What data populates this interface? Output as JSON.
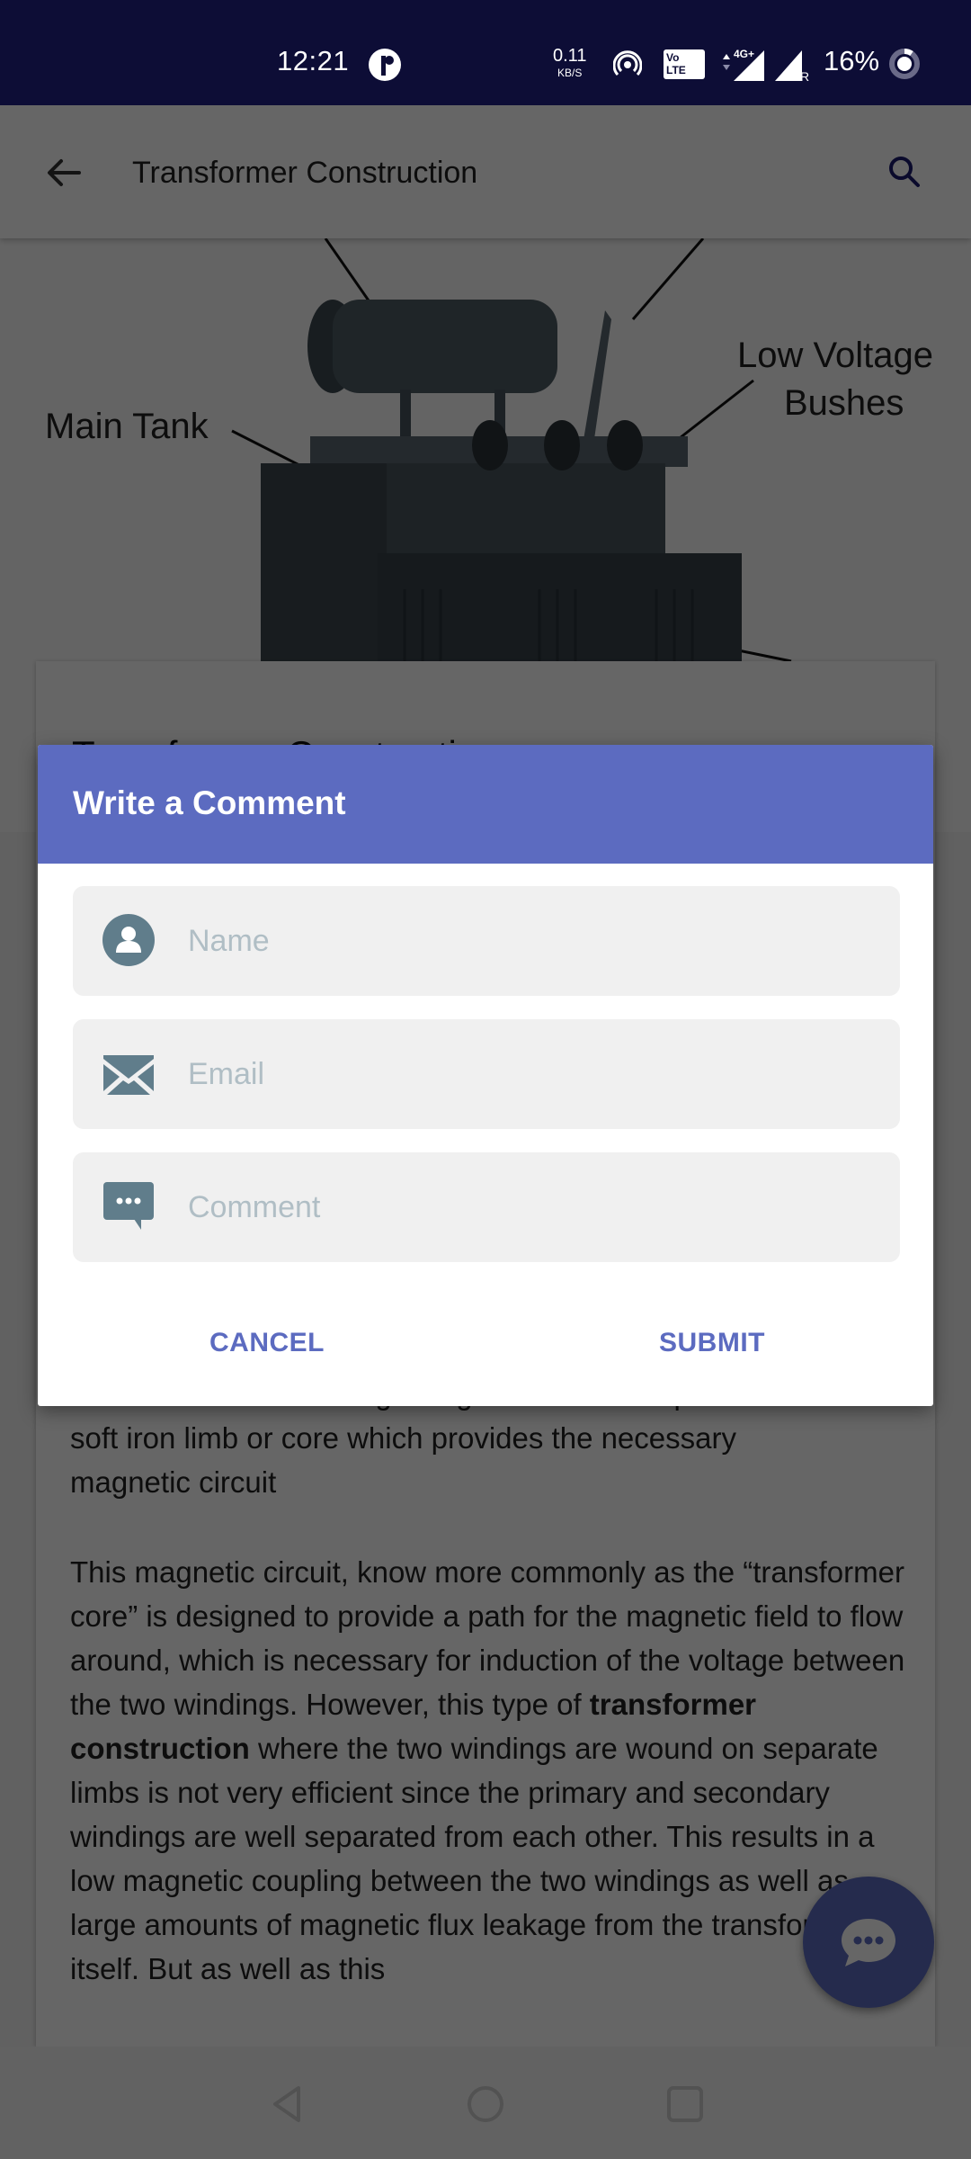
{
  "status_bar": {
    "time": "12:21",
    "net_speed_value": "0.11",
    "net_speed_unit": "KB/S",
    "volte_label_top": "Vo",
    "volte_label_bottom": "LTE",
    "network_type": "4G+",
    "roaming_label": "R",
    "battery_percent": "16%"
  },
  "app_bar": {
    "title": "Transformer Construction"
  },
  "hero_image": {
    "labels": [
      "Main Tank",
      "Low Voltage",
      "Bushes"
    ],
    "partial_labels": [
      "T",
      "g",
      "s"
    ]
  },
  "article": {
    "card_title": "Transformer Construction",
    "paragraph1_lines": [
      "consists of each winding being wound on a separate",
      "soft iron limb or core which provides the necessary",
      "magnetic circuit"
    ],
    "paragraph2": {
      "before_bold": "This magnetic circuit, know more commonly as the “transformer core” is designed to provide a path for the magnetic field to flow around, which is necessary for induction of the voltage between the two windings. However, this type of ",
      "bold": "transformer construction",
      "after_bold": " where the two windings are wound on separate limbs is not very efficient since the primary and secondary windings are well separated from each other. This results in a low magnetic coupling between the two windings as well as large amounts of magnetic flux leakage from the transformer itself. But as well as this"
    }
  },
  "dialog": {
    "title": "Write a Comment",
    "fields": [
      {
        "icon": "person-icon",
        "placeholder": "Name",
        "value": ""
      },
      {
        "icon": "envelope-icon",
        "placeholder": "Email",
        "value": ""
      },
      {
        "icon": "chat-bubble-icon",
        "placeholder": "Comment",
        "value": ""
      }
    ],
    "cancel_label": "CANCEL",
    "submit_label": "SUBMIT"
  },
  "colors": {
    "status_bar_bg": "#0d0d36",
    "dialog_header": "#5c6bc0",
    "button_text": "#5c6bc0",
    "field_bg": "#f0f0f0",
    "icon_color": "#607d8b",
    "placeholder_color": "#b0bec5",
    "fab_color": "#5c6bc0"
  }
}
